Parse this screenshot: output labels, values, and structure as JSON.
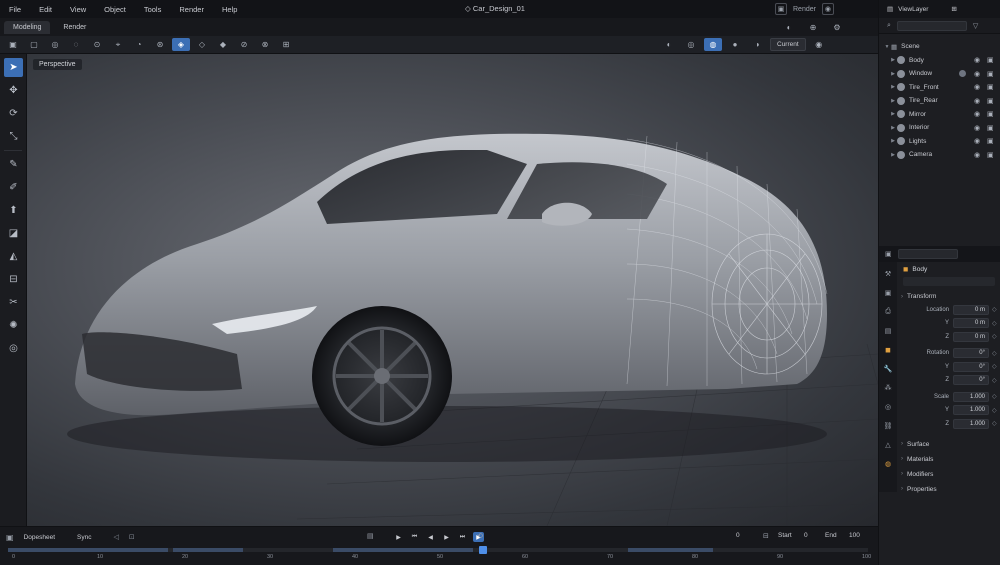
{
  "menu": {
    "items": [
      "File",
      "Edit",
      "View",
      "Object",
      "Tools",
      "Render",
      "Help"
    ],
    "document_title": "Car_Design_01",
    "right_label": "Render"
  },
  "workspace_tabs": [
    {
      "label": "Modeling",
      "active": true
    },
    {
      "label": "Render",
      "active": false
    }
  ],
  "toolbar": {
    "shading_dropdown": "Current"
  },
  "viewport": {
    "label": "Perspective"
  },
  "right_panel": {
    "layer_label": "ViewLayer",
    "outliner": {
      "root": "Scene",
      "items": [
        {
          "name": "Body",
          "has_material": false
        },
        {
          "name": "Window",
          "has_material": true
        },
        {
          "name": "Tire_Front",
          "has_material": false
        },
        {
          "name": "Tire_Rear",
          "has_material": false
        },
        {
          "name": "Mirror",
          "has_material": false
        },
        {
          "name": "Interior",
          "has_material": false
        },
        {
          "name": "Lights",
          "has_material": false
        },
        {
          "name": "Camera",
          "has_material": false
        }
      ]
    },
    "properties": {
      "object_name": "Body",
      "transform_section": "Transform",
      "location_label": "Location",
      "location": [
        {
          "axis": "",
          "value": "0 m"
        },
        {
          "axis": "Y",
          "value": "0 m"
        },
        {
          "axis": "Z",
          "value": "0 m"
        }
      ],
      "rotation_label": "Rotation",
      "rotation": [
        {
          "axis": "",
          "value": "0°"
        },
        {
          "axis": "Y",
          "value": "0°"
        },
        {
          "axis": "Z",
          "value": "0°"
        }
      ],
      "scale_label": "Scale",
      "scale": [
        {
          "axis": "",
          "value": "1.000"
        },
        {
          "axis": "Y",
          "value": "1.000"
        },
        {
          "axis": "Z",
          "value": "1.000"
        }
      ],
      "collapsed_sections": [
        "Surface",
        "Materials",
        "Modifiers",
        "Properties"
      ]
    }
  },
  "timeline": {
    "mode_dropdown": "Dopesheet",
    "sync_dropdown": "Sync",
    "current_frame": "0",
    "start_label": "Start",
    "start_value": "0",
    "end_label": "End",
    "end_value": "100",
    "ticks": [
      "0",
      "10",
      "20",
      "30",
      "40",
      "50",
      "60",
      "70",
      "80",
      "90",
      "100"
    ]
  },
  "colors": {
    "accent": "#3c6fb5",
    "panel_bg": "#1d1e22",
    "viewport_bg": "#4d5057"
  }
}
